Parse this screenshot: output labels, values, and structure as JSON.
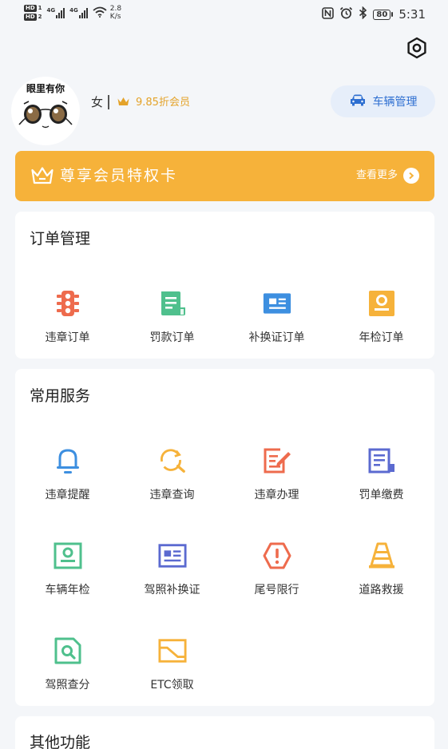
{
  "status_bar": {
    "hd1": "HD",
    "hd1_num": "1",
    "hd2": "HD",
    "hd2_num": "2",
    "net1": "4G",
    "net2": "4G",
    "speed_value": "2.8",
    "speed_unit": "K/s",
    "battery": "80",
    "time": "5:31"
  },
  "profile": {
    "avatar_text": "眼里有你",
    "gender": "女",
    "member_label": "9.85折会员",
    "vehicle_button": "车辆管理"
  },
  "banner": {
    "title": "尊享会员特权卡",
    "more_label": "查看更多"
  },
  "orders": {
    "title": "订单管理",
    "items": [
      {
        "label": "违章订单",
        "icon": "traffic-light-icon",
        "color": "#ee6b4d"
      },
      {
        "label": "罚款订单",
        "icon": "document-icon",
        "color": "#4fc08d"
      },
      {
        "label": "补换证订单",
        "icon": "id-card-icon",
        "color": "#3d8fe0"
      },
      {
        "label": "年检订单",
        "icon": "inspection-icon",
        "color": "#f6b23a"
      }
    ]
  },
  "services": {
    "title": "常用服务",
    "items": [
      {
        "label": "违章提醒",
        "icon": "bell-icon",
        "color": "#3d8fe0"
      },
      {
        "label": "违章查询",
        "icon": "search-refresh-icon",
        "color": "#f6b23a"
      },
      {
        "label": "违章办理",
        "icon": "edit-doc-icon",
        "color": "#ee6b4d"
      },
      {
        "label": "罚单缴费",
        "icon": "ticket-icon",
        "color": "#5b6ad0"
      },
      {
        "label": "车辆年检",
        "icon": "inspection-card-icon",
        "color": "#4fc08d"
      },
      {
        "label": "驾照补换证",
        "icon": "license-icon",
        "color": "#5b6ad0"
      },
      {
        "label": "尾号限行",
        "icon": "warning-icon",
        "color": "#ee6b4d"
      },
      {
        "label": "道路救援",
        "icon": "traffic-cone-icon",
        "color": "#f6b23a"
      },
      {
        "label": "驾照查分",
        "icon": "search-doc-icon",
        "color": "#4fc08d"
      },
      {
        "label": "ETC领取",
        "icon": "etc-card-icon",
        "color": "#f6b23a"
      }
    ]
  },
  "other": {
    "title": "其他功能"
  },
  "colors": {
    "accent_gold": "#f6b23a",
    "member_gold": "#e4a32a",
    "brand_blue": "#2e6fd1",
    "background": "#f4f6f9"
  }
}
